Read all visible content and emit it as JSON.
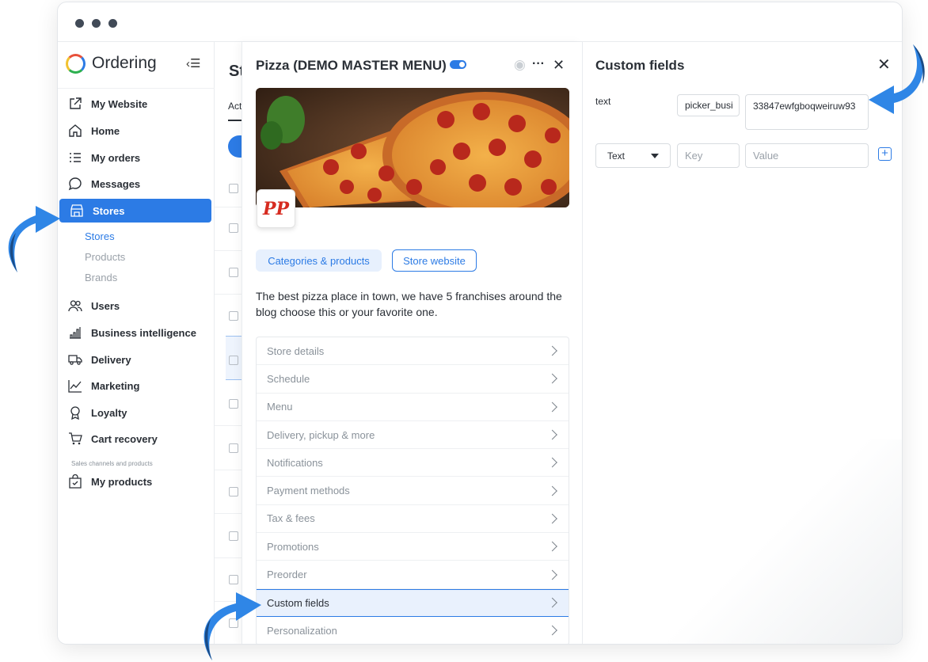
{
  "window": {
    "dots": 3
  },
  "sidebar": {
    "brand": "Ordering",
    "items": [
      {
        "label": "My Website",
        "icon": "external-link-icon"
      },
      {
        "label": "Home",
        "icon": "home-icon"
      },
      {
        "label": "My orders",
        "icon": "list-icon"
      },
      {
        "label": "Messages",
        "icon": "chat-bubble-icon"
      },
      {
        "label": "Stores",
        "icon": "shop-icon",
        "active": true
      },
      {
        "label": "Users",
        "icon": "users-icon"
      },
      {
        "label": "Business intelligence",
        "icon": "bar-chart-icon"
      },
      {
        "label": "Delivery",
        "icon": "truck-icon"
      },
      {
        "label": "Marketing",
        "icon": "trend-icon"
      },
      {
        "label": "Loyalty",
        "icon": "award-icon"
      },
      {
        "label": "Cart recovery",
        "icon": "cart-icon"
      },
      {
        "label": "My products",
        "icon": "bag-check-icon"
      }
    ],
    "sub_items": [
      "Stores",
      "Products",
      "Brands"
    ],
    "section_label": "Sales channels and products"
  },
  "page": {
    "title": "St",
    "tab": "Act"
  },
  "store_panel": {
    "title": "Pizza (DEMO MASTER MENU)",
    "logo_text": "PP",
    "chip_primary": "Categories & products",
    "chip_secondary": "Store website",
    "description": "The best pizza place in town, we have 5 franchises around the blog choose this or your favorite one.",
    "menu": [
      "Store details",
      "Schedule",
      "Menu",
      "Delivery, pickup & more",
      "Notifications",
      "Payment methods",
      "Tax & fees",
      "Promotions",
      "Preorder",
      "Custom fields",
      "Personalization"
    ],
    "active_menu": "Custom fields"
  },
  "custom_fields": {
    "title": "Custom fields",
    "row_label": "text",
    "key_value": "picker_busi",
    "value_value": "33847ewfgboqweiruw93",
    "type_select": "Text",
    "key_placeholder": "Key",
    "value_placeholder": "Value"
  },
  "colors": {
    "accent": "#2c7be5",
    "arrow": "#2f86e6",
    "arrow_dark": "#1a4b86"
  }
}
